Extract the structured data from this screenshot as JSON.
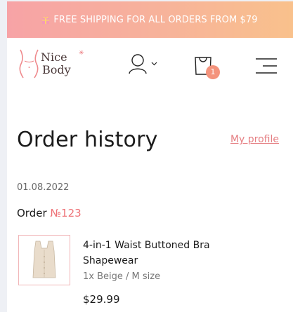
{
  "promo": {
    "text": "FREE SHIPPING FOR ALL ORDERS FROM $79",
    "icon": "gift-icon"
  },
  "header": {
    "logo": {
      "line1": "Nice",
      "line2": "Body",
      "mark": "body-silhouette-icon"
    },
    "account_icon": "user-icon",
    "cart": {
      "icon": "shopping-bag-icon",
      "count": "1"
    },
    "menu_icon": "hamburger-menu-icon"
  },
  "page": {
    "title": "Order history",
    "profile_link": "My profile"
  },
  "order": {
    "date": "01.08.2022",
    "label": "Order",
    "number": "№123",
    "item": {
      "name": "4-in-1 Waist Buttoned Bra Shapewear",
      "variant": "1x Beige / M size",
      "price": "$29.99"
    }
  },
  "colors": {
    "accent": "#ee7277",
    "promo_gradient_start": "#f7a3a6",
    "promo_gradient_end": "#f9c18c",
    "badge": "#f4937c"
  }
}
